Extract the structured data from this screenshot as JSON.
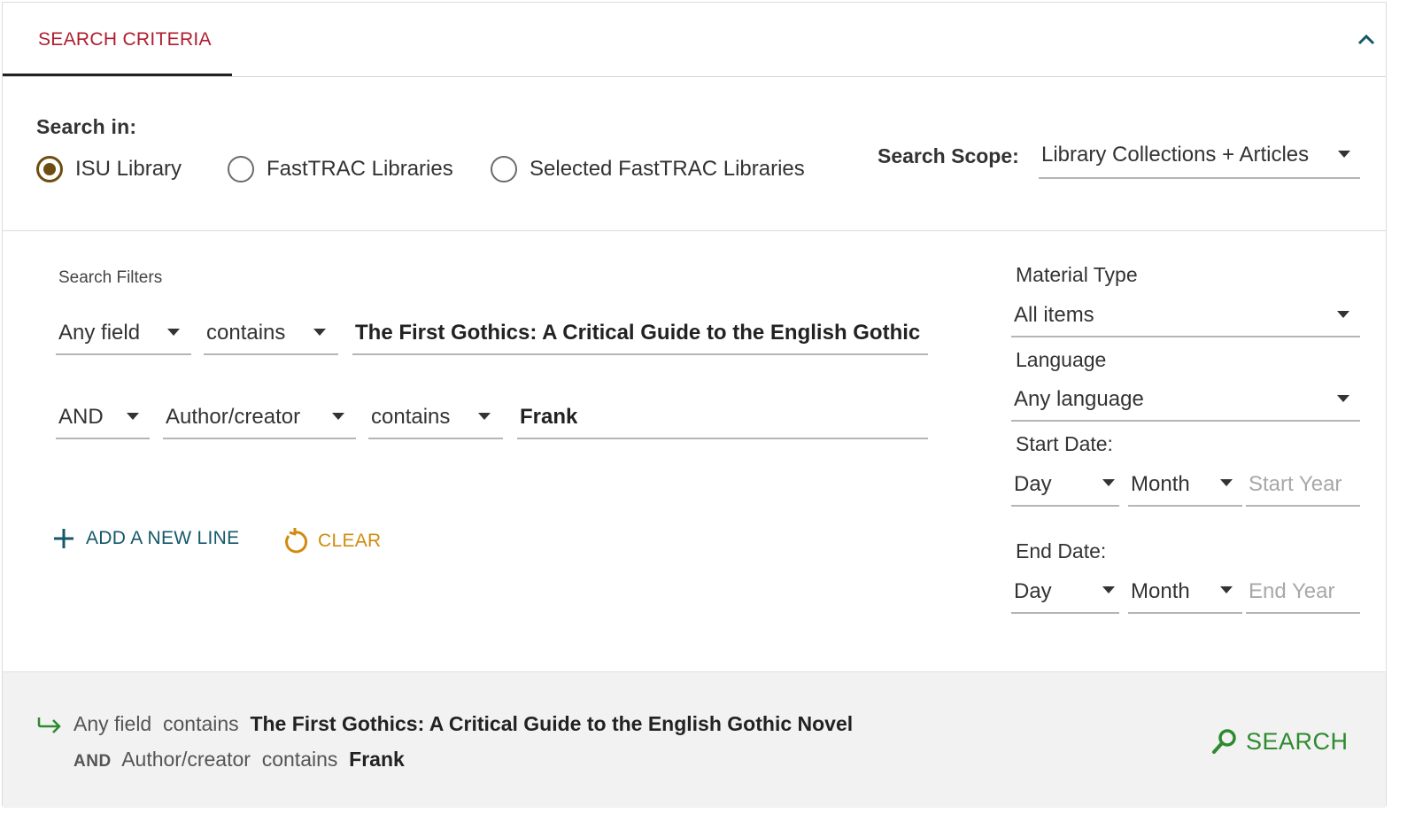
{
  "header": {
    "tab_label": "SEARCH CRITERIA",
    "accent_color": "#b01c2e"
  },
  "search_in": {
    "label": "Search in:",
    "options": [
      {
        "label": "ISU Library",
        "checked": true
      },
      {
        "label": "FastTRAC Libraries",
        "checked": false
      },
      {
        "label": "Selected FastTRAC Libraries",
        "checked": false
      }
    ]
  },
  "scope": {
    "label": "Search Scope:",
    "value": "Library Collections + Articles"
  },
  "filters": {
    "label": "Search Filters",
    "row1": {
      "field": "Any field",
      "operator": "contains",
      "value": "The First Gothics: A Critical Guide to the English Gothic Nov"
    },
    "row2": {
      "boolean": "AND",
      "field": "Author/creator",
      "operator": "contains",
      "value": "Frank"
    },
    "add_line_label": "ADD A NEW LINE",
    "clear_label": "CLEAR"
  },
  "right_panel": {
    "material_type_label": "Material Type",
    "material_type_value": "All items",
    "language_label": "Language",
    "language_value": "Any language",
    "start_date_label": "Start Date:",
    "start_day": "Day",
    "start_month": "Month",
    "start_year_placeholder": "Start Year",
    "end_date_label": "End Date:",
    "end_day": "Day",
    "end_month": "Month",
    "end_year_placeholder": "End Year"
  },
  "summary": {
    "line1_field": "Any field",
    "line1_operator": "contains",
    "line1_value": "The First Gothics: A Critical Guide to the English Gothic Novel",
    "line2_boolean": "AND",
    "line2_field": "Author/creator",
    "line2_operator": "contains",
    "line2_value": "Frank",
    "search_label": "SEARCH"
  }
}
